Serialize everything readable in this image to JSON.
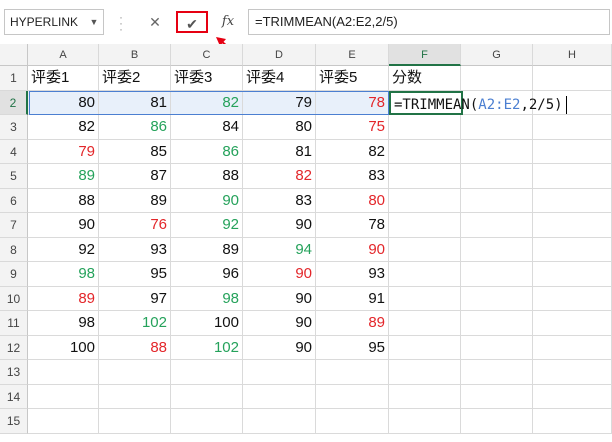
{
  "toolbar": {
    "name_box": "HYPERLINK",
    "cancel_glyph": "✕",
    "enter_glyph": "✔",
    "fx_label": "fx",
    "formula_text": "=TRIMMEAN(A2:E2,2/5)"
  },
  "columns": [
    "A",
    "B",
    "C",
    "D",
    "E",
    "F",
    "G",
    "H"
  ],
  "rows": [
    "1",
    "2",
    "3",
    "4",
    "5",
    "6",
    "7",
    "8",
    "9",
    "10",
    "11",
    "12",
    "13",
    "14",
    "15"
  ],
  "headers": [
    "评委1",
    "评委2",
    "评委3",
    "评委4",
    "评委5",
    "分数"
  ],
  "table": [
    [
      {
        "v": "80",
        "c": "black"
      },
      {
        "v": "81",
        "c": "black"
      },
      {
        "v": "82",
        "c": "green"
      },
      {
        "v": "79",
        "c": "black"
      },
      {
        "v": "78",
        "c": "red"
      }
    ],
    [
      {
        "v": "82",
        "c": "black"
      },
      {
        "v": "86",
        "c": "green"
      },
      {
        "v": "84",
        "c": "black"
      },
      {
        "v": "80",
        "c": "black"
      },
      {
        "v": "75",
        "c": "red"
      }
    ],
    [
      {
        "v": "79",
        "c": "red"
      },
      {
        "v": "85",
        "c": "black"
      },
      {
        "v": "86",
        "c": "green"
      },
      {
        "v": "81",
        "c": "black"
      },
      {
        "v": "82",
        "c": "black"
      }
    ],
    [
      {
        "v": "89",
        "c": "green"
      },
      {
        "v": "87",
        "c": "black"
      },
      {
        "v": "88",
        "c": "black"
      },
      {
        "v": "82",
        "c": "red"
      },
      {
        "v": "83",
        "c": "black"
      }
    ],
    [
      {
        "v": "88",
        "c": "black"
      },
      {
        "v": "89",
        "c": "black"
      },
      {
        "v": "90",
        "c": "green"
      },
      {
        "v": "83",
        "c": "black"
      },
      {
        "v": "80",
        "c": "red"
      }
    ],
    [
      {
        "v": "90",
        "c": "black"
      },
      {
        "v": "76",
        "c": "red"
      },
      {
        "v": "92",
        "c": "green"
      },
      {
        "v": "90",
        "c": "black"
      },
      {
        "v": "78",
        "c": "black"
      }
    ],
    [
      {
        "v": "92",
        "c": "black"
      },
      {
        "v": "93",
        "c": "black"
      },
      {
        "v": "89",
        "c": "black"
      },
      {
        "v": "94",
        "c": "green"
      },
      {
        "v": "90",
        "c": "red"
      }
    ],
    [
      {
        "v": "98",
        "c": "green"
      },
      {
        "v": "95",
        "c": "black"
      },
      {
        "v": "96",
        "c": "black"
      },
      {
        "v": "90",
        "c": "red"
      },
      {
        "v": "93",
        "c": "black"
      }
    ],
    [
      {
        "v": "89",
        "c": "red"
      },
      {
        "v": "97",
        "c": "black"
      },
      {
        "v": "98",
        "c": "green"
      },
      {
        "v": "90",
        "c": "black"
      },
      {
        "v": "91",
        "c": "black"
      }
    ],
    [
      {
        "v": "98",
        "c": "black"
      },
      {
        "v": "102",
        "c": "green"
      },
      {
        "v": "100",
        "c": "black"
      },
      {
        "v": "90",
        "c": "black"
      },
      {
        "v": "89",
        "c": "red"
      }
    ],
    [
      {
        "v": "100",
        "c": "black"
      },
      {
        "v": "88",
        "c": "red"
      },
      {
        "v": "102",
        "c": "green"
      },
      {
        "v": "90",
        "c": "black"
      },
      {
        "v": "95",
        "c": "black"
      }
    ]
  ],
  "active_cell": {
    "prefix": "=TRIMMEAN(",
    "ref": "A2:E2",
    "suffix": ",2/5)"
  },
  "colors": {
    "red": "#e3262a",
    "green": "#25a25b",
    "accent": "#217346",
    "ref_blue": "#4b7fd1",
    "highlight_box": "#e60012"
  }
}
